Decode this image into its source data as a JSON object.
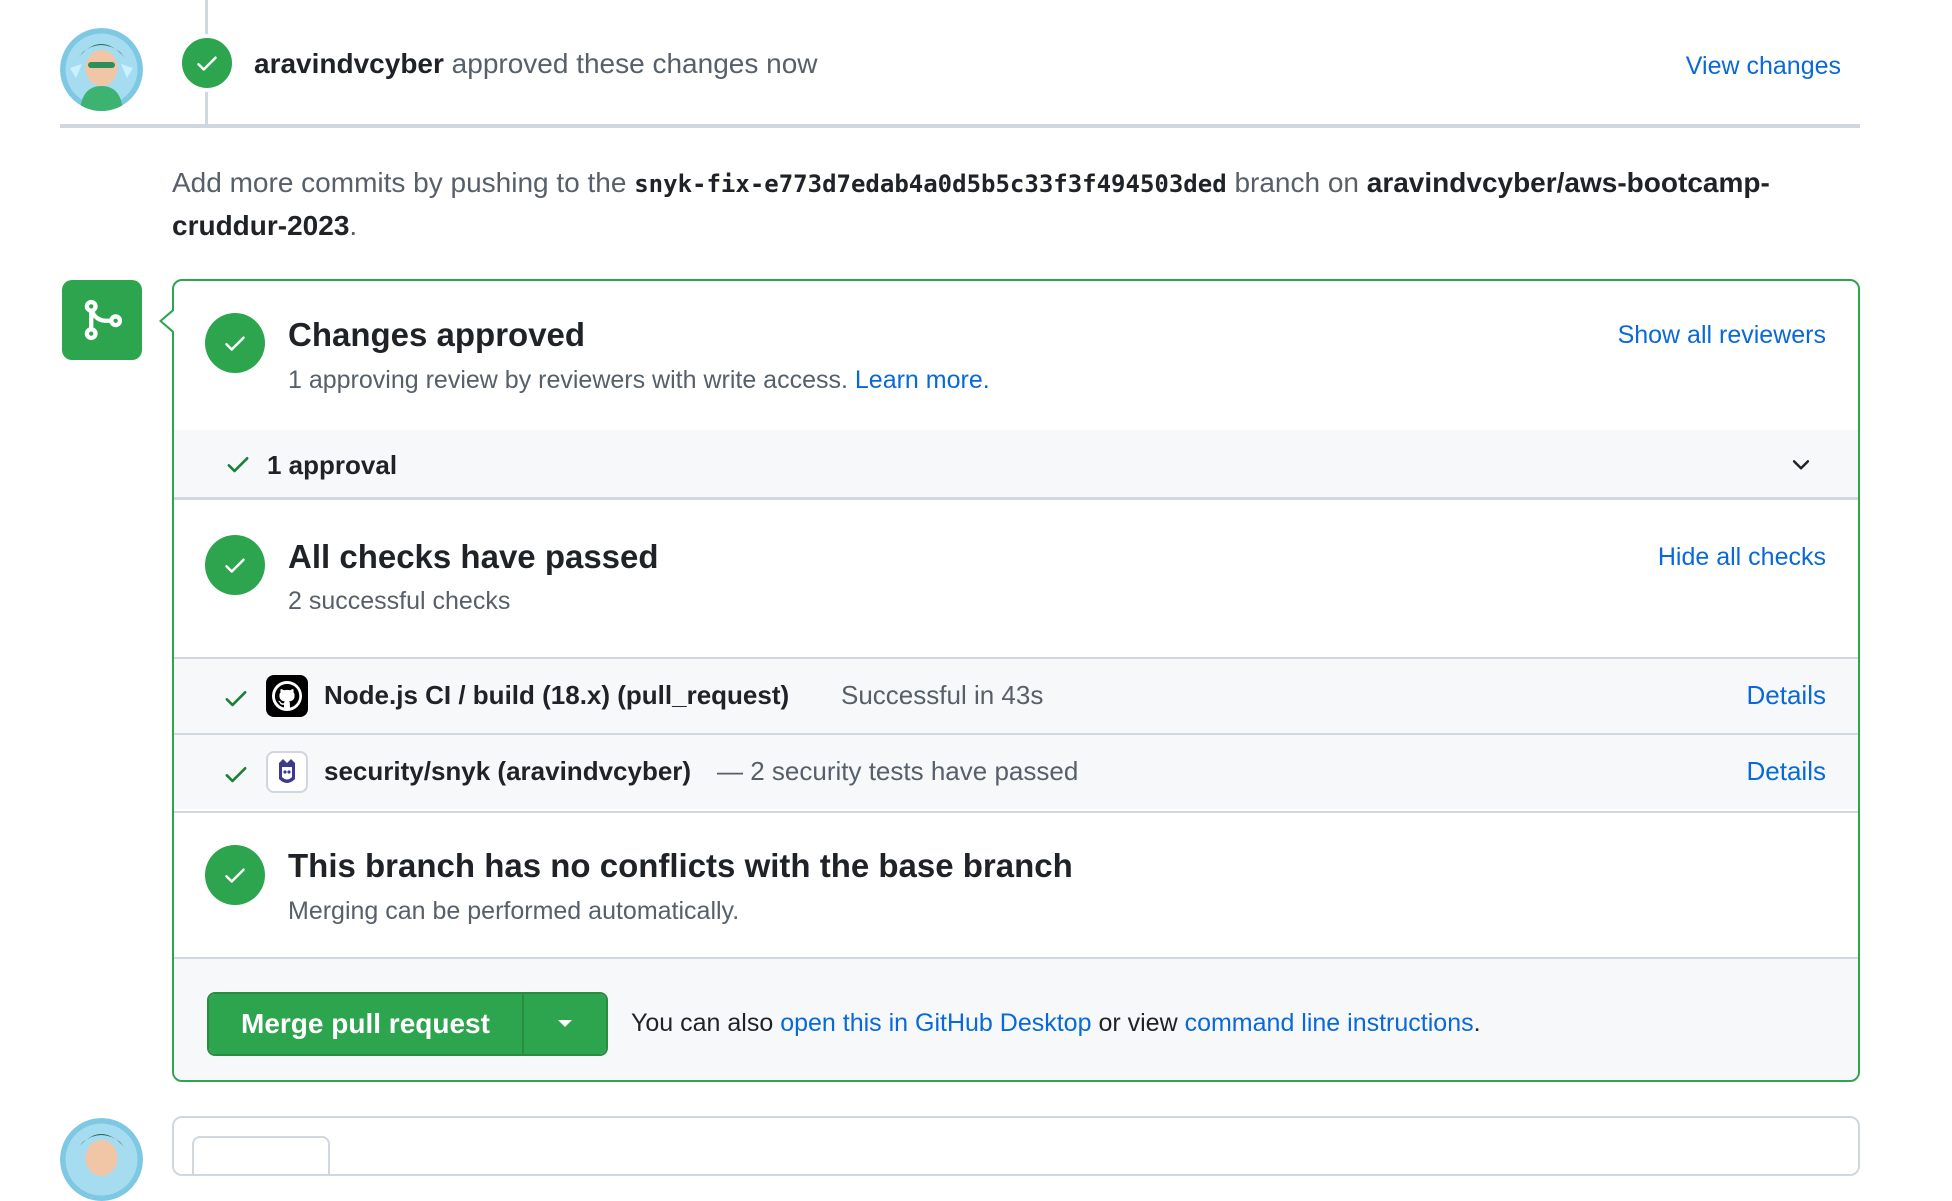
{
  "event": {
    "author": "aravindvcyber",
    "action": "approved these changes now",
    "view_changes": "View changes"
  },
  "info": {
    "prefix": "Add more commits by pushing to the",
    "branch": "snyk-fix-e773d7edab4a0d5b5c33f3f494503ded",
    "middle": "branch on",
    "repo": "aravindvcyber/aws-bootcamp-cruddur-2023",
    "suffix": "."
  },
  "approval_section": {
    "title": "Changes approved",
    "subtitle": "1 approving review by reviewers with write access.",
    "learn_more": "Learn more.",
    "show_reviewers": "Show all reviewers",
    "approval_count": "1 approval"
  },
  "checks_section": {
    "title": "All checks have passed",
    "subtitle": "2 successful checks",
    "hide_checks": "Hide all checks",
    "checks": [
      {
        "name": "Node.js CI / build (18.x) (pull_request)",
        "description": "Successful in 43s",
        "details": "Details",
        "icon": "github-mark-icon"
      },
      {
        "name": "security/snyk (aravindvcyber)",
        "description": "— 2 security tests have passed",
        "details": "Details",
        "icon": "snyk-logo-icon"
      }
    ]
  },
  "conflicts_section": {
    "title": "This branch has no conflicts with the base branch",
    "subtitle": "Merging can be performed automatically."
  },
  "merge_footer": {
    "button_label": "Merge pull request",
    "text_prefix": "You can also",
    "desktop_link": "open this in GitHub Desktop",
    "text_middle": "or view",
    "cli_link": "command line instructions",
    "text_suffix": "."
  },
  "colors": {
    "success_green": "#2da44e",
    "link_blue": "#0969da",
    "border_gray": "#d0d7de",
    "muted_text": "#57606a"
  }
}
